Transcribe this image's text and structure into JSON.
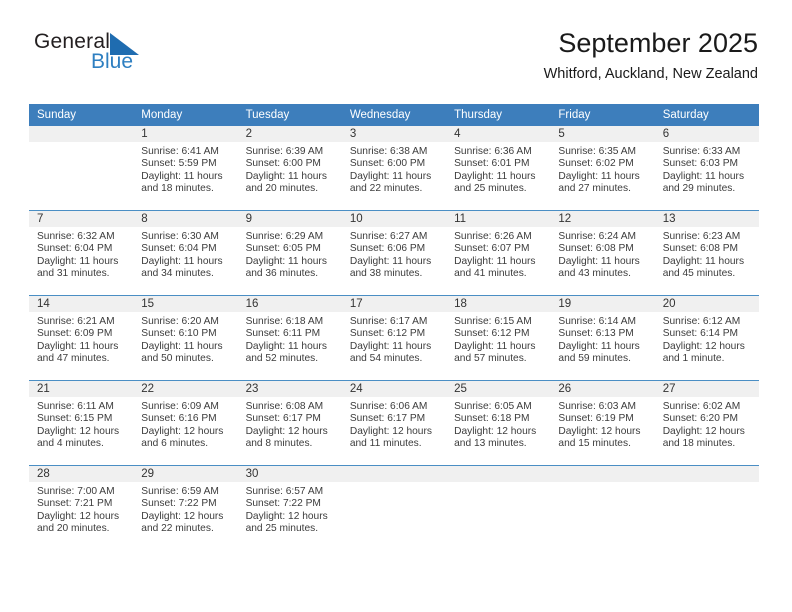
{
  "brand": {
    "name_part1": "General",
    "name_part2": "Blue",
    "mark": "triangle-flag-icon",
    "accent_color": "#2e7fc1"
  },
  "header": {
    "month_title": "September 2025",
    "location": "Whitford, Auckland, New Zealand"
  },
  "colors": {
    "header_blue": "#3d7ebc",
    "row_divider": "#4a8ec4",
    "daynum_bg": "#f0f0f0"
  },
  "calendar": {
    "weekday_headers": [
      "Sunday",
      "Monday",
      "Tuesday",
      "Wednesday",
      "Thursday",
      "Friday",
      "Saturday"
    ],
    "weeks": [
      [
        {
          "day": "",
          "empty": true,
          "sunrise": "",
          "sunset": "",
          "daylight_line1": "",
          "daylight_line2": ""
        },
        {
          "day": "1",
          "sunrise": "Sunrise: 6:41 AM",
          "sunset": "Sunset: 5:59 PM",
          "daylight_line1": "Daylight: 11 hours",
          "daylight_line2": "and 18 minutes."
        },
        {
          "day": "2",
          "sunrise": "Sunrise: 6:39 AM",
          "sunset": "Sunset: 6:00 PM",
          "daylight_line1": "Daylight: 11 hours",
          "daylight_line2": "and 20 minutes."
        },
        {
          "day": "3",
          "sunrise": "Sunrise: 6:38 AM",
          "sunset": "Sunset: 6:00 PM",
          "daylight_line1": "Daylight: 11 hours",
          "daylight_line2": "and 22 minutes."
        },
        {
          "day": "4",
          "sunrise": "Sunrise: 6:36 AM",
          "sunset": "Sunset: 6:01 PM",
          "daylight_line1": "Daylight: 11 hours",
          "daylight_line2": "and 25 minutes."
        },
        {
          "day": "5",
          "sunrise": "Sunrise: 6:35 AM",
          "sunset": "Sunset: 6:02 PM",
          "daylight_line1": "Daylight: 11 hours",
          "daylight_line2": "and 27 minutes."
        },
        {
          "day": "6",
          "sunrise": "Sunrise: 6:33 AM",
          "sunset": "Sunset: 6:03 PM",
          "daylight_line1": "Daylight: 11 hours",
          "daylight_line2": "and 29 minutes."
        }
      ],
      [
        {
          "day": "7",
          "sunrise": "Sunrise: 6:32 AM",
          "sunset": "Sunset: 6:04 PM",
          "daylight_line1": "Daylight: 11 hours",
          "daylight_line2": "and 31 minutes."
        },
        {
          "day": "8",
          "sunrise": "Sunrise: 6:30 AM",
          "sunset": "Sunset: 6:04 PM",
          "daylight_line1": "Daylight: 11 hours",
          "daylight_line2": "and 34 minutes."
        },
        {
          "day": "9",
          "sunrise": "Sunrise: 6:29 AM",
          "sunset": "Sunset: 6:05 PM",
          "daylight_line1": "Daylight: 11 hours",
          "daylight_line2": "and 36 minutes."
        },
        {
          "day": "10",
          "sunrise": "Sunrise: 6:27 AM",
          "sunset": "Sunset: 6:06 PM",
          "daylight_line1": "Daylight: 11 hours",
          "daylight_line2": "and 38 minutes."
        },
        {
          "day": "11",
          "sunrise": "Sunrise: 6:26 AM",
          "sunset": "Sunset: 6:07 PM",
          "daylight_line1": "Daylight: 11 hours",
          "daylight_line2": "and 41 minutes."
        },
        {
          "day": "12",
          "sunrise": "Sunrise: 6:24 AM",
          "sunset": "Sunset: 6:08 PM",
          "daylight_line1": "Daylight: 11 hours",
          "daylight_line2": "and 43 minutes."
        },
        {
          "day": "13",
          "sunrise": "Sunrise: 6:23 AM",
          "sunset": "Sunset: 6:08 PM",
          "daylight_line1": "Daylight: 11 hours",
          "daylight_line2": "and 45 minutes."
        }
      ],
      [
        {
          "day": "14",
          "sunrise": "Sunrise: 6:21 AM",
          "sunset": "Sunset: 6:09 PM",
          "daylight_line1": "Daylight: 11 hours",
          "daylight_line2": "and 47 minutes."
        },
        {
          "day": "15",
          "sunrise": "Sunrise: 6:20 AM",
          "sunset": "Sunset: 6:10 PM",
          "daylight_line1": "Daylight: 11 hours",
          "daylight_line2": "and 50 minutes."
        },
        {
          "day": "16",
          "sunrise": "Sunrise: 6:18 AM",
          "sunset": "Sunset: 6:11 PM",
          "daylight_line1": "Daylight: 11 hours",
          "daylight_line2": "and 52 minutes."
        },
        {
          "day": "17",
          "sunrise": "Sunrise: 6:17 AM",
          "sunset": "Sunset: 6:12 PM",
          "daylight_line1": "Daylight: 11 hours",
          "daylight_line2": "and 54 minutes."
        },
        {
          "day": "18",
          "sunrise": "Sunrise: 6:15 AM",
          "sunset": "Sunset: 6:12 PM",
          "daylight_line1": "Daylight: 11 hours",
          "daylight_line2": "and 57 minutes."
        },
        {
          "day": "19",
          "sunrise": "Sunrise: 6:14 AM",
          "sunset": "Sunset: 6:13 PM",
          "daylight_line1": "Daylight: 11 hours",
          "daylight_line2": "and 59 minutes."
        },
        {
          "day": "20",
          "sunrise": "Sunrise: 6:12 AM",
          "sunset": "Sunset: 6:14 PM",
          "daylight_line1": "Daylight: 12 hours",
          "daylight_line2": "and 1 minute."
        }
      ],
      [
        {
          "day": "21",
          "sunrise": "Sunrise: 6:11 AM",
          "sunset": "Sunset: 6:15 PM",
          "daylight_line1": "Daylight: 12 hours",
          "daylight_line2": "and 4 minutes."
        },
        {
          "day": "22",
          "sunrise": "Sunrise: 6:09 AM",
          "sunset": "Sunset: 6:16 PM",
          "daylight_line1": "Daylight: 12 hours",
          "daylight_line2": "and 6 minutes."
        },
        {
          "day": "23",
          "sunrise": "Sunrise: 6:08 AM",
          "sunset": "Sunset: 6:17 PM",
          "daylight_line1": "Daylight: 12 hours",
          "daylight_line2": "and 8 minutes."
        },
        {
          "day": "24",
          "sunrise": "Sunrise: 6:06 AM",
          "sunset": "Sunset: 6:17 PM",
          "daylight_line1": "Daylight: 12 hours",
          "daylight_line2": "and 11 minutes."
        },
        {
          "day": "25",
          "sunrise": "Sunrise: 6:05 AM",
          "sunset": "Sunset: 6:18 PM",
          "daylight_line1": "Daylight: 12 hours",
          "daylight_line2": "and 13 minutes."
        },
        {
          "day": "26",
          "sunrise": "Sunrise: 6:03 AM",
          "sunset": "Sunset: 6:19 PM",
          "daylight_line1": "Daylight: 12 hours",
          "daylight_line2": "and 15 minutes."
        },
        {
          "day": "27",
          "sunrise": "Sunrise: 6:02 AM",
          "sunset": "Sunset: 6:20 PM",
          "daylight_line1": "Daylight: 12 hours",
          "daylight_line2": "and 18 minutes."
        }
      ],
      [
        {
          "day": "28",
          "sunrise": "Sunrise: 7:00 AM",
          "sunset": "Sunset: 7:21 PM",
          "daylight_line1": "Daylight: 12 hours",
          "daylight_line2": "and 20 minutes."
        },
        {
          "day": "29",
          "sunrise": "Sunrise: 6:59 AM",
          "sunset": "Sunset: 7:22 PM",
          "daylight_line1": "Daylight: 12 hours",
          "daylight_line2": "and 22 minutes."
        },
        {
          "day": "30",
          "sunrise": "Sunrise: 6:57 AM",
          "sunset": "Sunset: 7:22 PM",
          "daylight_line1": "Daylight: 12 hours",
          "daylight_line2": "and 25 minutes."
        },
        {
          "day": "",
          "empty": true,
          "sunrise": "",
          "sunset": "",
          "daylight_line1": "",
          "daylight_line2": ""
        },
        {
          "day": "",
          "empty": true,
          "sunrise": "",
          "sunset": "",
          "daylight_line1": "",
          "daylight_line2": ""
        },
        {
          "day": "",
          "empty": true,
          "sunrise": "",
          "sunset": "",
          "daylight_line1": "",
          "daylight_line2": ""
        },
        {
          "day": "",
          "empty": true,
          "sunrise": "",
          "sunset": "",
          "daylight_line1": "",
          "daylight_line2": ""
        }
      ]
    ]
  }
}
